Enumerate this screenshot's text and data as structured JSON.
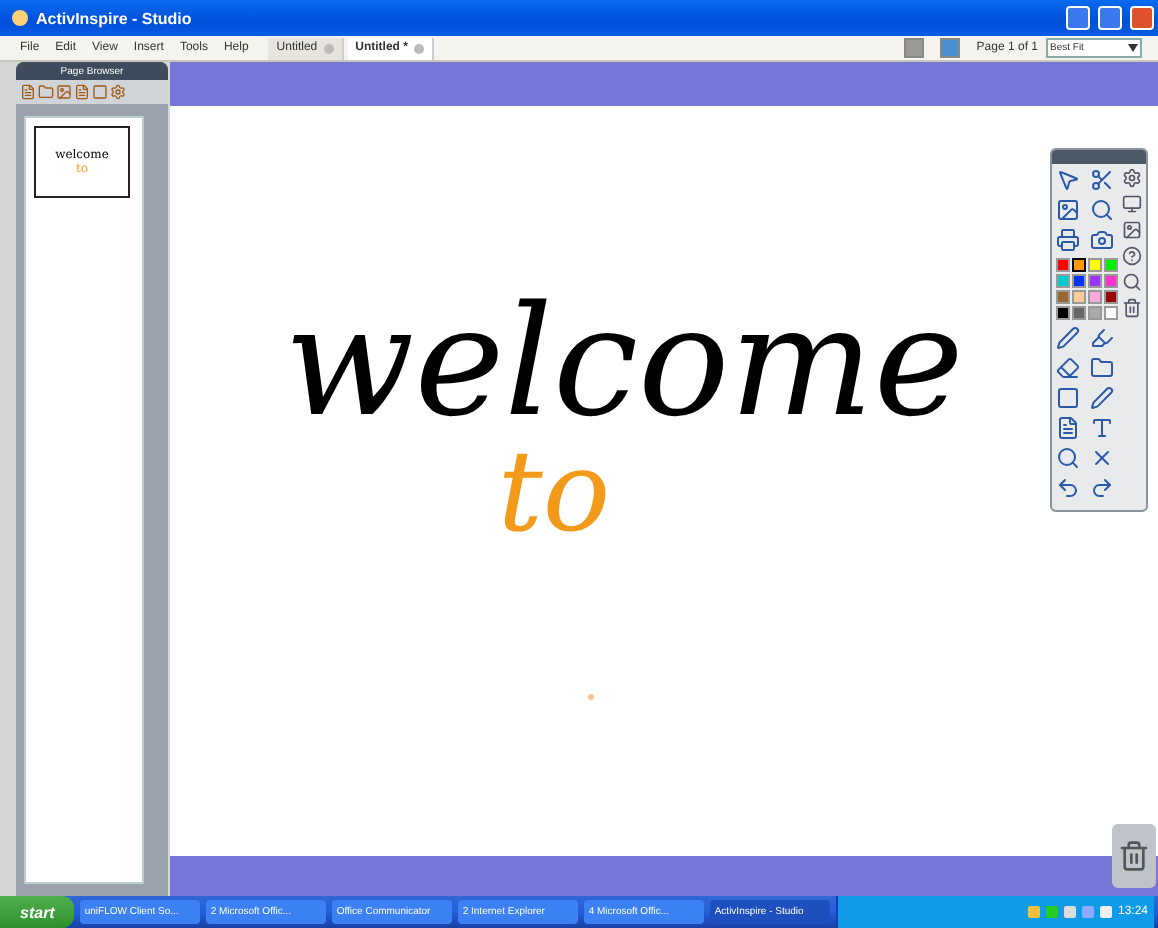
{
  "window": {
    "title": "ActivInspire - Studio"
  },
  "menu": [
    "File",
    "Edit",
    "View",
    "Insert",
    "Tools",
    "Help"
  ],
  "tabs": [
    {
      "label": "Untitled",
      "selected": false
    },
    {
      "label": "Untitled *",
      "selected": true
    }
  ],
  "page_indicator": "Page 1 of 1",
  "zoom_select": {
    "value": "Best Fit"
  },
  "page_browser": {
    "title": "Page Browser",
    "thumbnail": {
      "word_1": "welcome",
      "word_2": "to"
    }
  },
  "canvas": {
    "ink": [
      {
        "text": "welcome",
        "color": "#000000"
      },
      {
        "text": "to",
        "color": "#f39a1a"
      }
    ]
  },
  "palette": [
    {
      "color": "#ff0000",
      "selected": false
    },
    {
      "color": "#ff9900",
      "selected": true
    },
    {
      "color": "#ffff00",
      "selected": false
    },
    {
      "color": "#00ee00",
      "selected": false
    },
    {
      "color": "#00cccc",
      "selected": false
    },
    {
      "color": "#0033ff",
      "selected": false
    },
    {
      "color": "#9933ff",
      "selected": false
    },
    {
      "color": "#ff33cc",
      "selected": false
    },
    {
      "color": "#996633",
      "selected": false
    },
    {
      "color": "#ffcc99",
      "selected": false
    },
    {
      "color": "#ffaadd",
      "selected": false
    },
    {
      "color": "#990000",
      "selected": false
    },
    {
      "color": "#000000",
      "selected": false
    },
    {
      "color": "#666666",
      "selected": false
    },
    {
      "color": "#aaaaaa",
      "selected": false
    },
    {
      "color": "#ffffff",
      "selected": false
    }
  ],
  "taskbar": {
    "start": "start",
    "items": [
      {
        "label": "uniFLOW Client So...",
        "selected": false
      },
      {
        "label": "2 Microsoft Offic...",
        "selected": false
      },
      {
        "label": "Office Communicator",
        "selected": false
      },
      {
        "label": "2 Internet Explorer",
        "selected": false
      },
      {
        "label": "4 Microsoft Offic...",
        "selected": false
      },
      {
        "label": "ActivInspire - Studio",
        "selected": true
      }
    ],
    "clock": "13:24"
  }
}
